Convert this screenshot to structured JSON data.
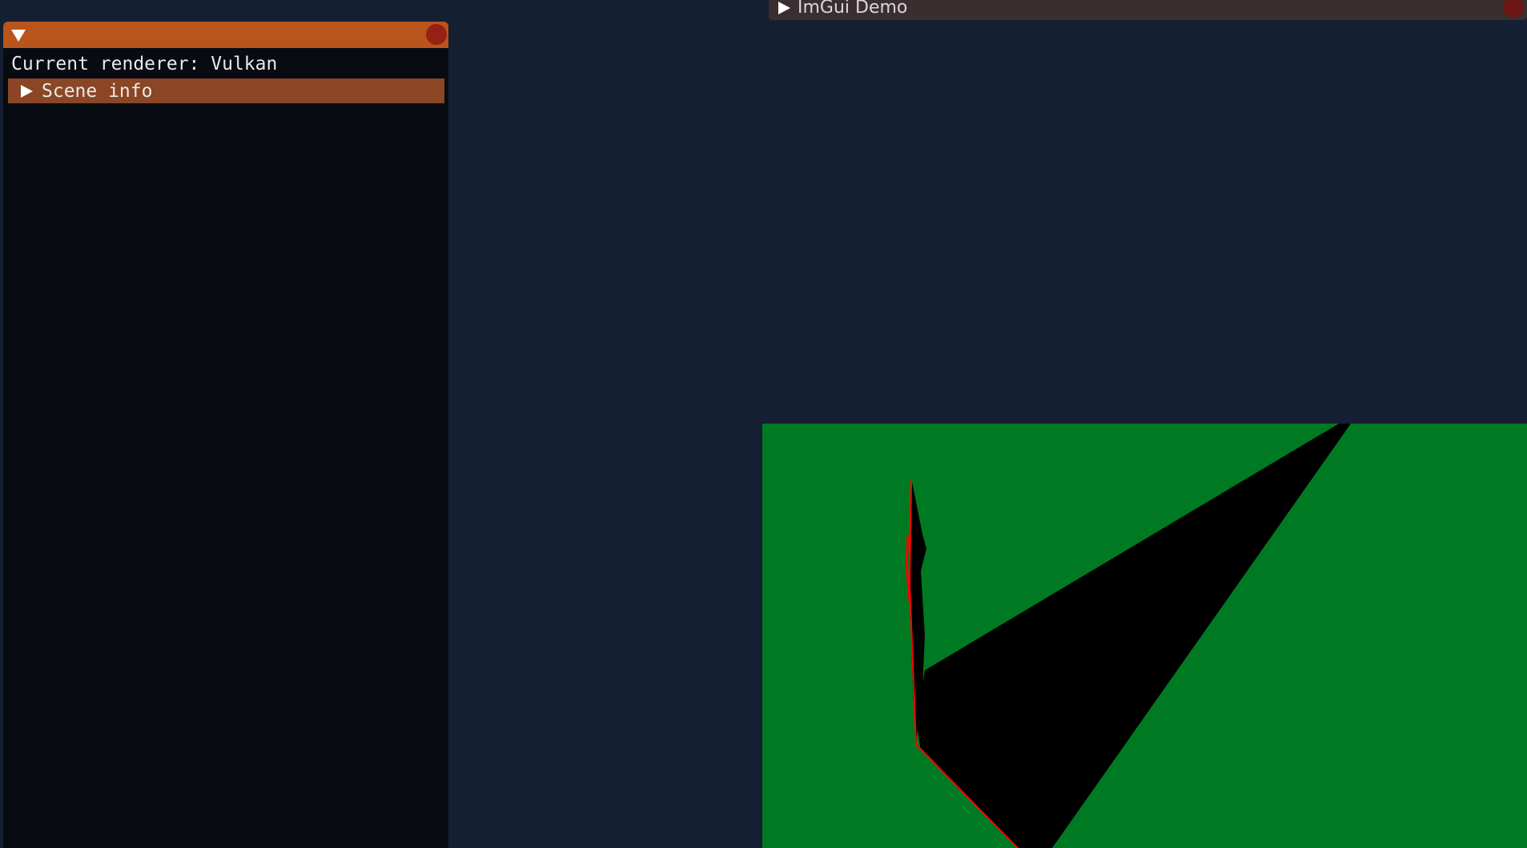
{
  "renderer_window": {
    "renderer_text": "Current renderer: Vulkan",
    "scene_info_label": "Scene info"
  },
  "demo_window": {
    "title": "ImGui Demo"
  },
  "colors": {
    "background": "#142032",
    "titlebar_active": "#b9541c",
    "header": "#8a4625",
    "scene_ground": "#007a22",
    "scene_object": "#000000",
    "edge_highlight": "#ff0000"
  }
}
